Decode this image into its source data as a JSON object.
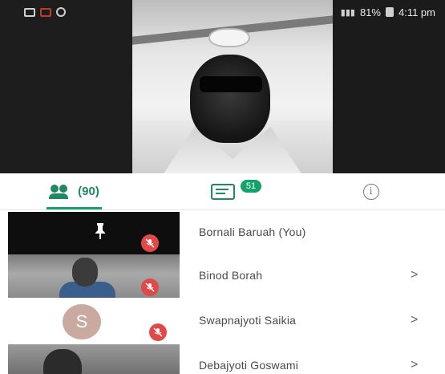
{
  "status_bar": {
    "battery": "81%",
    "time": "4:11 pm"
  },
  "tabs": [
    {
      "name": "participants",
      "label": "(90)",
      "icon": "people-icon",
      "active": true
    },
    {
      "name": "chat",
      "badge": "51",
      "icon": "chat-icon",
      "active": false
    },
    {
      "name": "info",
      "icon": "info-icon",
      "active": false
    }
  ],
  "participants": [
    {
      "name": "Bornali Baruah (You)",
      "muted": true,
      "chevron": ""
    },
    {
      "name": "Binod Borah",
      "muted": true,
      "chevron": ">"
    },
    {
      "name": "Swapnajyoti Saikia",
      "muted": true,
      "chevron": ">",
      "avatar_letter": "S"
    },
    {
      "name": "Debajyoti Goswami",
      "muted": false,
      "chevron": ">"
    }
  ],
  "colors": {
    "accent": "#12a26a",
    "muted_badge": "#e24848"
  }
}
